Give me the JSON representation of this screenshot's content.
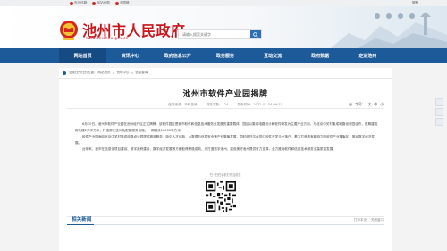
{
  "topbar": {
    "links": [
      "市长信箱",
      "网站地图",
      "无障碍"
    ],
    "lang": "繁體"
  },
  "header": {
    "title": "池州市人民政府",
    "url": "www.chizhou.gov.cn",
    "search_placeholder": "请输入搜索关键字"
  },
  "nav": {
    "items": [
      "网站首页",
      "资讯中心",
      "政府信息公开",
      "政务服务",
      "互动交流",
      "政府数据",
      "走进池州"
    ]
  },
  "breadcrumb": {
    "label": "您现在所在的位置：",
    "items": [
      "网站首页",
      "资讯中心",
      "信息要闻"
    ]
  },
  "article": {
    "title": "池州市软件产业园揭牌",
    "meta": {
      "source": "信息来源：市科技局",
      "views": "浏览次数：124",
      "date": "发布时间：2022-07-04 09:21"
    },
    "tools": {
      "font_label": "字号：",
      "sizes": [
        "大",
        "中",
        "小"
      ]
    },
    "paragraphs": [
      "6月30日，池州市软件产业园在池州经开区正式揭牌。该软件园区是我市软件和信息技术服务业发展的重要载体，园区以集成电路设计和软件研发为主要产业方向，与北京中关村集成电路设计园合作，首期建成孵化楼2万平方米，打造孵化空间及配套服务设施，一期建设10000平方米。",
      "软件产业园面向北京中关村集成电路设计园提供精准服务，吸引人才创新，大数据与信息安全等产业集聚发展，同时依托平台招引软件开发企业落户，着力打造具有影响力的软件产业集聚区，推动数字经济发展。",
      "近年来，我市在信息化项目建设、数字政府建设、数字经济发展等方面取得积极成效，为打造数字池州、建设美好池州提供有力支撑，全力推动软件和信息技术服务业高质量发展。"
    ],
    "qr_caption": "扫一扫在手机打开当前页"
  },
  "footer_meta": {
    "print": "打印本页",
    "close": "关闭窗口"
  },
  "related": {
    "title": "相关新闻"
  },
  "colors": {
    "brand_red": "#c8161d",
    "nav_blue": "#1d5a99",
    "nav_active": "#164a82"
  }
}
